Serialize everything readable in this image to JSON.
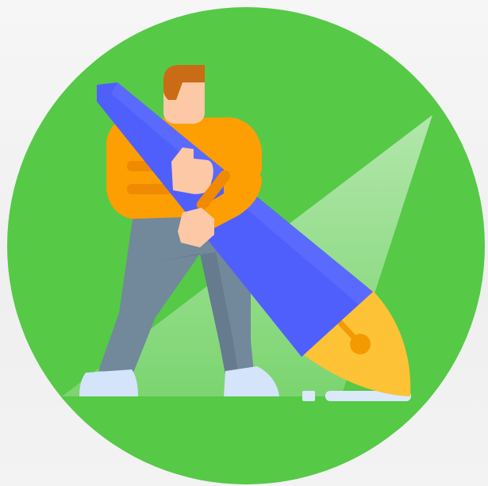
{
  "illustration": {
    "subject": "person-holding-giant-fountain-pen",
    "colors": {
      "background": "#f4f4f4",
      "circle": "#56c947",
      "pen_body": "#4f5ffc",
      "pen_nib": "#fdc236",
      "shirt": "#fd9e02",
      "pants": "#72889b",
      "skin": "#fdc8a6",
      "hair": "#c96c15",
      "shoes": "#d4e4fb"
    }
  }
}
